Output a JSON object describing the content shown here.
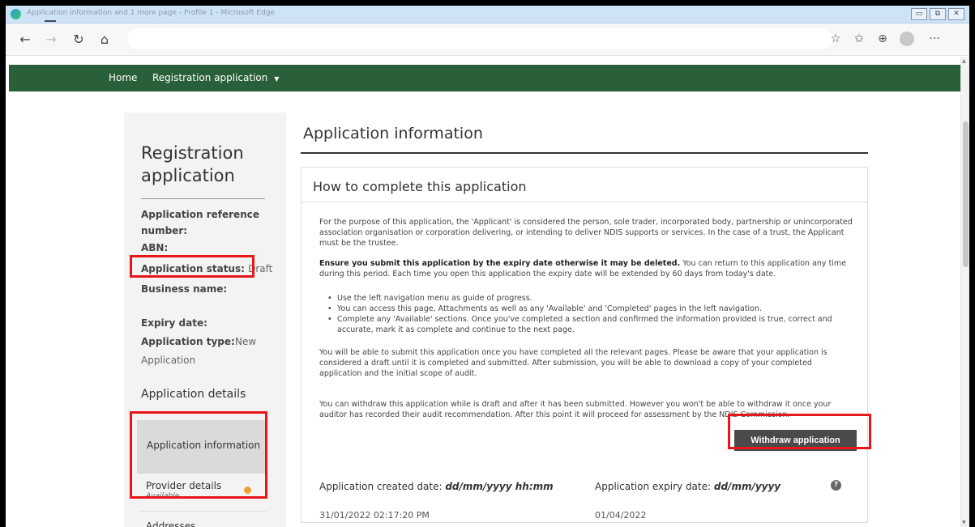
{
  "window": {
    "title": "Application information and 1 more page - Profile 1 - Microsoft Edge",
    "controls": [
      "minimize",
      "restore",
      "close"
    ]
  },
  "browser": {
    "address": "",
    "icons": [
      "back-icon",
      "forward-icon",
      "refresh-icon",
      "home-icon",
      "read-aloud-icon",
      "favorites-icon",
      "collections-icon",
      "profile-icon",
      "more-icon"
    ]
  },
  "topnav": {
    "home": "Home",
    "registration": "Registration application"
  },
  "sidebar": {
    "title": "Registration application",
    "ref_label": "Application reference number:",
    "abn_label": "ABN:",
    "status_label": "Application status:",
    "status_value": "Draft",
    "business_label": "Business name:",
    "expiry_label": "Expiry date:",
    "type_label": "Application type:",
    "type_value": "New Application",
    "details_heading": "Application details",
    "nav": [
      {
        "label": "Application information",
        "status": ""
      },
      {
        "label": "Provider details",
        "status": "Available"
      },
      {
        "label": "Addresses",
        "status": ""
      }
    ],
    "status_color": "#f0a030"
  },
  "main": {
    "title": "Application information",
    "panel_title": "How to complete this application",
    "p1": "For the purpose of this application, the 'Applicant' is considered the person, sole trader, incorporated body, partnership or unincorporated association organisation or corporation delivering, or intending to deliver NDIS supports or services. In the case of a trust, the Applicant must be the trustee.",
    "p2_bold": "Ensure you submit this application by the expiry date otherwise it may be deleted.",
    "p2_rest": " You can return to this application any time during this period. Each time you open this application the expiry date will be extended by 60 days from today's date.",
    "bullets": [
      "Use the left navigation menu as guide of progress.",
      "You can access this page, Attachments as well as any 'Available' and 'Completed' pages in the left navigation.",
      "Complete any 'Available' sections. Once you've completed a section and confirmed the information provided is true, correct and accurate, mark it as complete and continue to the next page."
    ],
    "p3": "You will be able to submit this application once you have completed all the relevant pages. Please be aware that your application is considered a draft until it is completed and submitted. After submission, you will be able to download a copy of your completed application and the initial scope of audit.",
    "p4": "You can withdraw this application while is draft and after it has been submitted. However you won't be able to withdraw it once your auditor has recorded their audit recommendation. After this point it will proceed for assessment by the NDIS Commission.",
    "withdraw_label": "Withdraw application",
    "created_label": "Application created date:",
    "created_format": "dd/mm/yyyy hh:mm",
    "created_value": "31/01/2022 02:17:20 PM",
    "expiry_label": "Application expiry date:",
    "expiry_format": "dd/mm/yyyy",
    "expiry_value": "01/04/2022"
  },
  "colors": {
    "nav_green": "#2a6039",
    "highlight_red": "#e8161b",
    "button_dark": "#4a4a4a"
  }
}
